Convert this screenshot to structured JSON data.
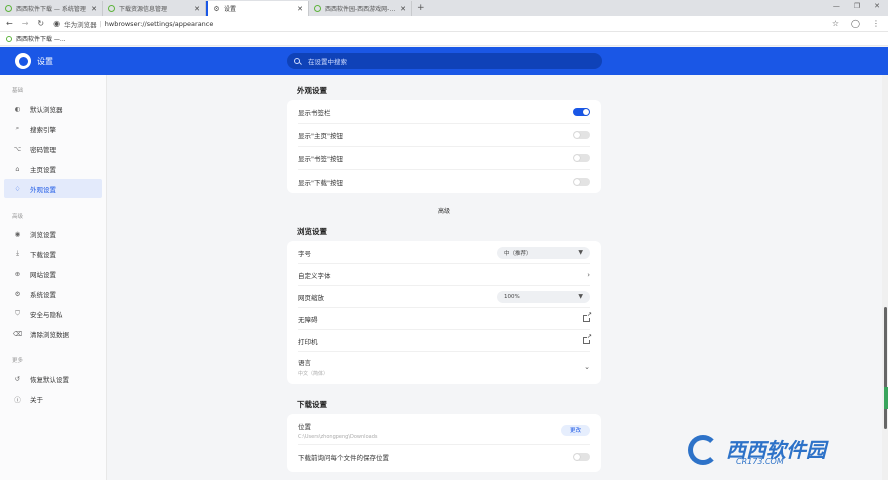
{
  "tabs": [
    {
      "title": "西西软件下载 — 系统管理",
      "active": false
    },
    {
      "title": "下载资源信息管理",
      "active": false
    },
    {
      "title": "设置",
      "active": true
    },
    {
      "title": "西西软件园-西西游戏网-多彩",
      "active": false
    }
  ],
  "address": {
    "site": "华为浏览器",
    "url": "hwbrowser://settings/appearance"
  },
  "bookmarks": [
    {
      "title": "西西软件下载 —..."
    }
  ],
  "header": {
    "title": "设置",
    "search_placeholder": "在设置中搜索"
  },
  "sidebar": {
    "sections": [
      {
        "title": "基础",
        "items": [
          {
            "icon": "◐",
            "label": "默认浏览器"
          },
          {
            "icon": "⌕",
            "label": "搜索引擎"
          },
          {
            "icon": "⌥",
            "label": "密码管理"
          },
          {
            "icon": "⌂",
            "label": "主页设置"
          },
          {
            "icon": "♢",
            "label": "外观设置",
            "active": true
          }
        ]
      },
      {
        "title": "高级",
        "items": [
          {
            "icon": "◉",
            "label": "浏览设置"
          },
          {
            "icon": "⤓",
            "label": "下载设置"
          },
          {
            "icon": "⊕",
            "label": "网站设置"
          },
          {
            "icon": "⚙",
            "label": "系统设置"
          },
          {
            "icon": "⛉",
            "label": "安全与隐私"
          },
          {
            "icon": "⌫",
            "label": "清除浏览数据"
          }
        ]
      },
      {
        "title": "更多",
        "items": [
          {
            "icon": "↺",
            "label": "恢复默认设置"
          },
          {
            "icon": "ⓘ",
            "label": "关于"
          }
        ]
      }
    ]
  },
  "appearance": {
    "title": "外观设置",
    "rows": [
      {
        "label": "显示书签栏",
        "toggle": true
      },
      {
        "label": "显示\"主页\"按钮",
        "toggle": false
      },
      {
        "label": "显示\"书签\"按钮",
        "toggle": false
      },
      {
        "label": "显示\"下载\"按钮",
        "toggle": false
      }
    ]
  },
  "divider_label": "高级",
  "browsing": {
    "title": "浏览设置",
    "rows": [
      {
        "label": "字号",
        "type": "select",
        "value": "中（推荐）"
      },
      {
        "label": "自定义字体",
        "type": "chevron-right"
      },
      {
        "label": "网页缩放",
        "type": "select",
        "value": "100%"
      },
      {
        "label": "无障碍",
        "type": "external"
      },
      {
        "label": "打印机",
        "type": "external"
      },
      {
        "label": "语言",
        "sub": "中文（简体）",
        "type": "chevron-down"
      }
    ]
  },
  "download": {
    "title": "下载设置",
    "location_label": "位置",
    "location_path": "C:\\Users\\zhongpeng\\Downloads",
    "change_button": "更改",
    "ask_label": "下载前询问每个文件的保存位置",
    "ask_toggle": false
  },
  "watermark": {
    "brand": "西西软件园",
    "url": "CR173.COM"
  },
  "colors": {
    "accent": "#1a57e6",
    "header_bg": "#1a57e6",
    "page_bg": "#f4f5f7"
  }
}
